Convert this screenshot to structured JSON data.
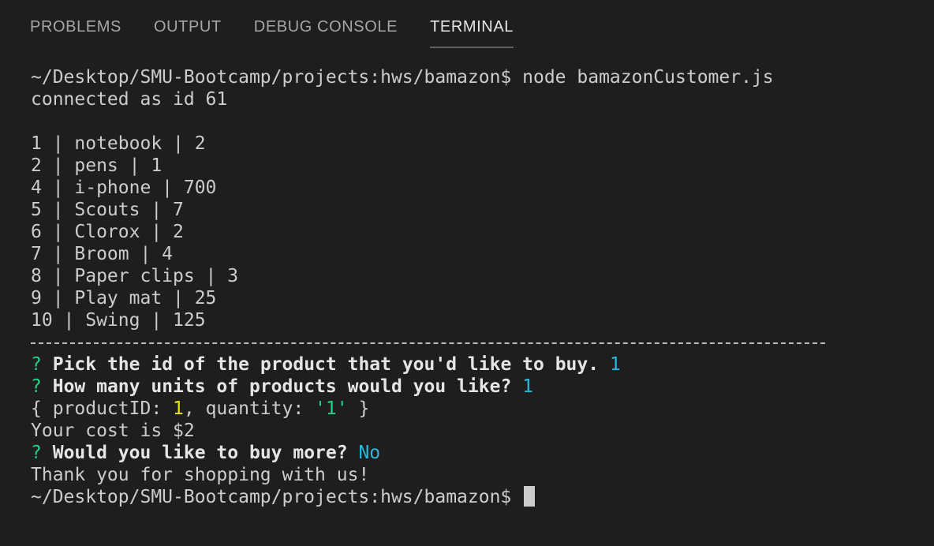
{
  "tabs": [
    {
      "label": "PROBLEMS",
      "active": false
    },
    {
      "label": "OUTPUT",
      "active": false
    },
    {
      "label": "DEBUG CONSOLE",
      "active": false
    },
    {
      "label": "TERMINAL",
      "active": true
    }
  ],
  "terminal": {
    "prompt": "~/Desktop/SMU-Bootcamp/projects:hws/bamazon$",
    "command": "node bamazonCustomer.js",
    "connected": "connected as id 61",
    "products": [
      "1 | notebook | 2",
      "2 | pens | 1",
      "4 | i-phone | 700",
      "5 | Scouts | 7",
      "6 | Clorox | 2",
      "7 | Broom | 4",
      "8 | Paper clips | 3",
      "9 | Play mat | 25",
      "10 | Swing | 125"
    ],
    "q_mark": "?",
    "q1": "Pick the id of the product that you'd like to buy.",
    "a1": "1",
    "q2": "How many units of products would you like?",
    "a2": "1",
    "obj_open": "{ productID: ",
    "obj_id": "1",
    "obj_mid": ", quantity: ",
    "obj_qty": "'1'",
    "obj_close": " }",
    "cost": "Your cost is $2",
    "q3": "Would you like to buy more?",
    "a3": "No",
    "thanks": "Thank you for shopping with us!"
  }
}
